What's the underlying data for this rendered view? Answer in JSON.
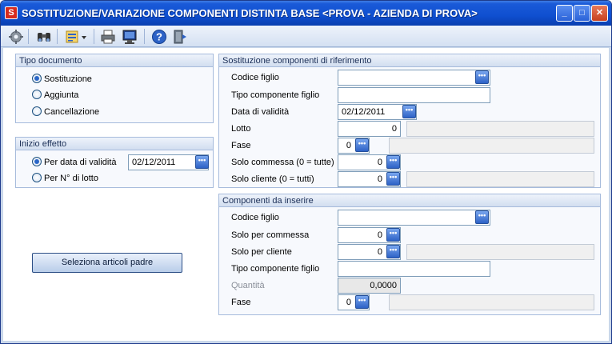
{
  "window": {
    "title": "SOSTITUZIONE/VARIAZIONE COMPONENTI DISTINTA BASE <PROVA - AZIENDA DI PROVA>",
    "app_icon": "S",
    "minimize_glyph": "_",
    "maximize_glyph": "□",
    "close_glyph": "✕"
  },
  "toolbar": {
    "icons": [
      "gear-icon",
      "binoculars-icon",
      "list-options-icon",
      "printer-icon",
      "monitor-preview-icon",
      "help-icon",
      "exit-door-icon"
    ]
  },
  "tipo_documento": {
    "title": "Tipo documento",
    "options": [
      {
        "label": "Sostituzione",
        "selected": true
      },
      {
        "label": "Aggiunta",
        "selected": false
      },
      {
        "label": "Cancellazione",
        "selected": false
      }
    ]
  },
  "inizio_effetto": {
    "title": "Inizio effetto",
    "option_data": "Per data di validità",
    "option_lotto": "Per N° di lotto",
    "data_value": "02/12/2011"
  },
  "seleziona_button": "Seleziona articoli padre",
  "sostituzione": {
    "title": "Sostituzione componenti di riferimento",
    "codice_figlio_label": "Codice figlio",
    "codice_figlio_value": "",
    "tipo_componente_label": "Tipo componente figlio",
    "tipo_componente_value": "",
    "data_validita_label": "Data di validità",
    "data_validita_value": "02/12/2011",
    "lotto_label": "Lotto",
    "lotto_value": "0",
    "fase_label": "Fase",
    "fase_value": "0",
    "solo_commessa_label": "Solo commessa (0 = tutte)",
    "solo_commessa_value": "0",
    "solo_cliente_label": "Solo cliente (0 = tutti)",
    "solo_cliente_value": "0"
  },
  "componenti": {
    "title": "Componenti da inserire",
    "codice_figlio_label": "Codice figlio",
    "codice_figlio_value": "",
    "solo_commessa_label": "Solo per commessa",
    "solo_commessa_value": "0",
    "solo_cliente_label": "Solo per cliente",
    "solo_cliente_value": "0",
    "tipo_componente_label": "Tipo componente figlio",
    "tipo_componente_value": "",
    "quantita_label": "Quantità",
    "quantita_value": "0,0000",
    "fase_label": "Fase",
    "fase_value": "0"
  },
  "lookup_glyph": "•••",
  "colors": {
    "titlebar": "#0f4fd0",
    "background": "#c9d7ea",
    "group_border": "#a6bbdc"
  }
}
